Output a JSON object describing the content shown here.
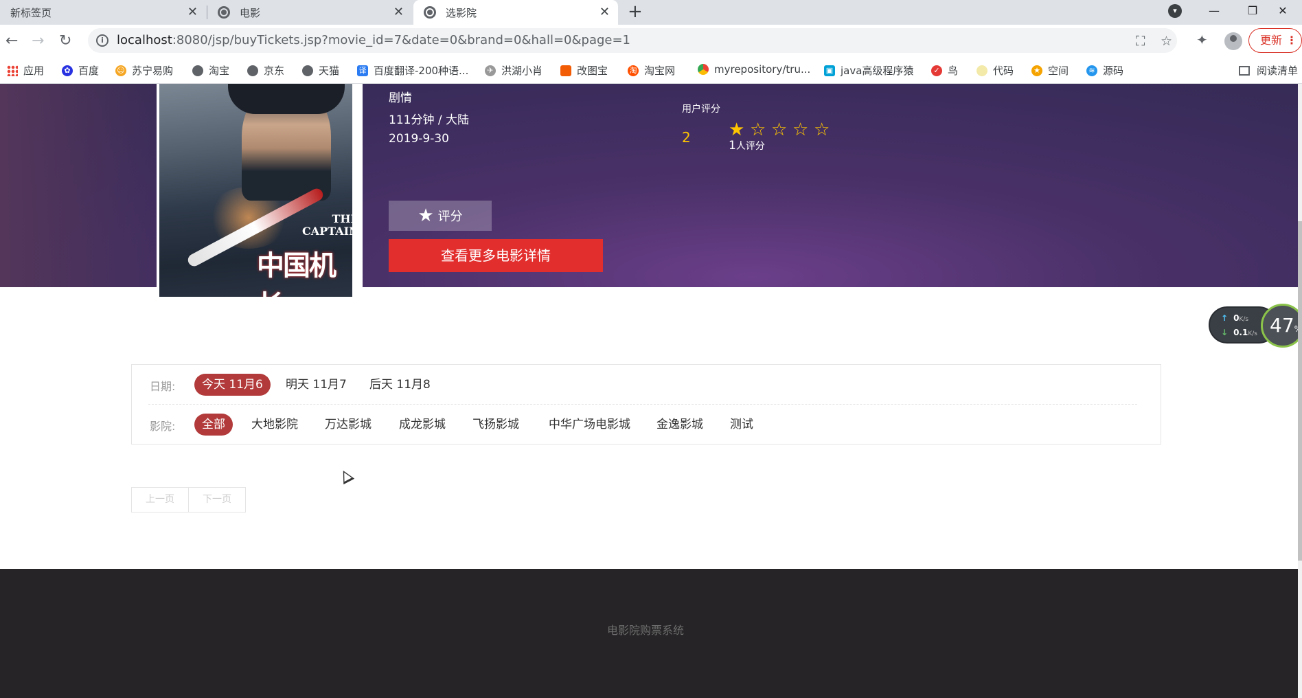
{
  "browser": {
    "tabs": [
      {
        "title": "新标签页"
      },
      {
        "title": "电影"
      },
      {
        "title": "选影院"
      }
    ],
    "url_host": "localhost",
    "url_rest": ":8080/jsp/buyTickets.jsp?movie_id=7&date=0&brand=0&hall=0&page=1",
    "update_label": "更新",
    "bookmarks": [
      "应用",
      "百度",
      "苏宁易购",
      "淘宝",
      "京东",
      "天猫",
      "百度翻译-200种语...",
      "洪湖小肖",
      "改图宝",
      "淘宝网",
      "myrepository/tru...",
      "java高级程序猿",
      "鸟",
      "代码",
      "空间",
      "源码"
    ],
    "reading_list": "阅读清单"
  },
  "movie": {
    "genre": "剧情",
    "duration_region": "111分钟 / 大陆",
    "release_date": "2019-9-30",
    "poster_title_en": "THE CAPTAIN",
    "poster_title_cn": "中国机长",
    "rating_label": "用户评分",
    "score": "2",
    "stars_filled": 1,
    "stars_total": 5,
    "rating_count": "1",
    "rating_count_suffix": "人评分",
    "rate_button": "评分",
    "detail_button": "查看更多电影详情"
  },
  "filters": {
    "date_label": "日期:",
    "dates": [
      {
        "label": "今天 11月6",
        "active": true
      },
      {
        "label": "明天 11月7",
        "active": false
      },
      {
        "label": "后天 11月8",
        "active": false
      }
    ],
    "cinema_label": "影院:",
    "cinemas": [
      {
        "label": "全部",
        "active": true
      },
      {
        "label": "大地影院",
        "active": false
      },
      {
        "label": "万达影城",
        "active": false
      },
      {
        "label": "成龙影城",
        "active": false
      },
      {
        "label": "飞扬影城",
        "active": false
      },
      {
        "label": "中华广场电影城",
        "active": false
      },
      {
        "label": "金逸影城",
        "active": false
      },
      {
        "label": "测试",
        "active": false
      }
    ]
  },
  "pagination": {
    "prev": "上一页",
    "next": "下一页"
  },
  "speed_widget": {
    "up": "0",
    "down": "0.1",
    "unit": "K/s",
    "percent": "47",
    "percent_sign": "%"
  },
  "footer": {
    "text": "电影院购票系统"
  },
  "colors": {
    "accent_red": "#e32e2e",
    "chip_active": "#b23a3a",
    "star": "#ffc600",
    "footer_bg": "#262426"
  }
}
